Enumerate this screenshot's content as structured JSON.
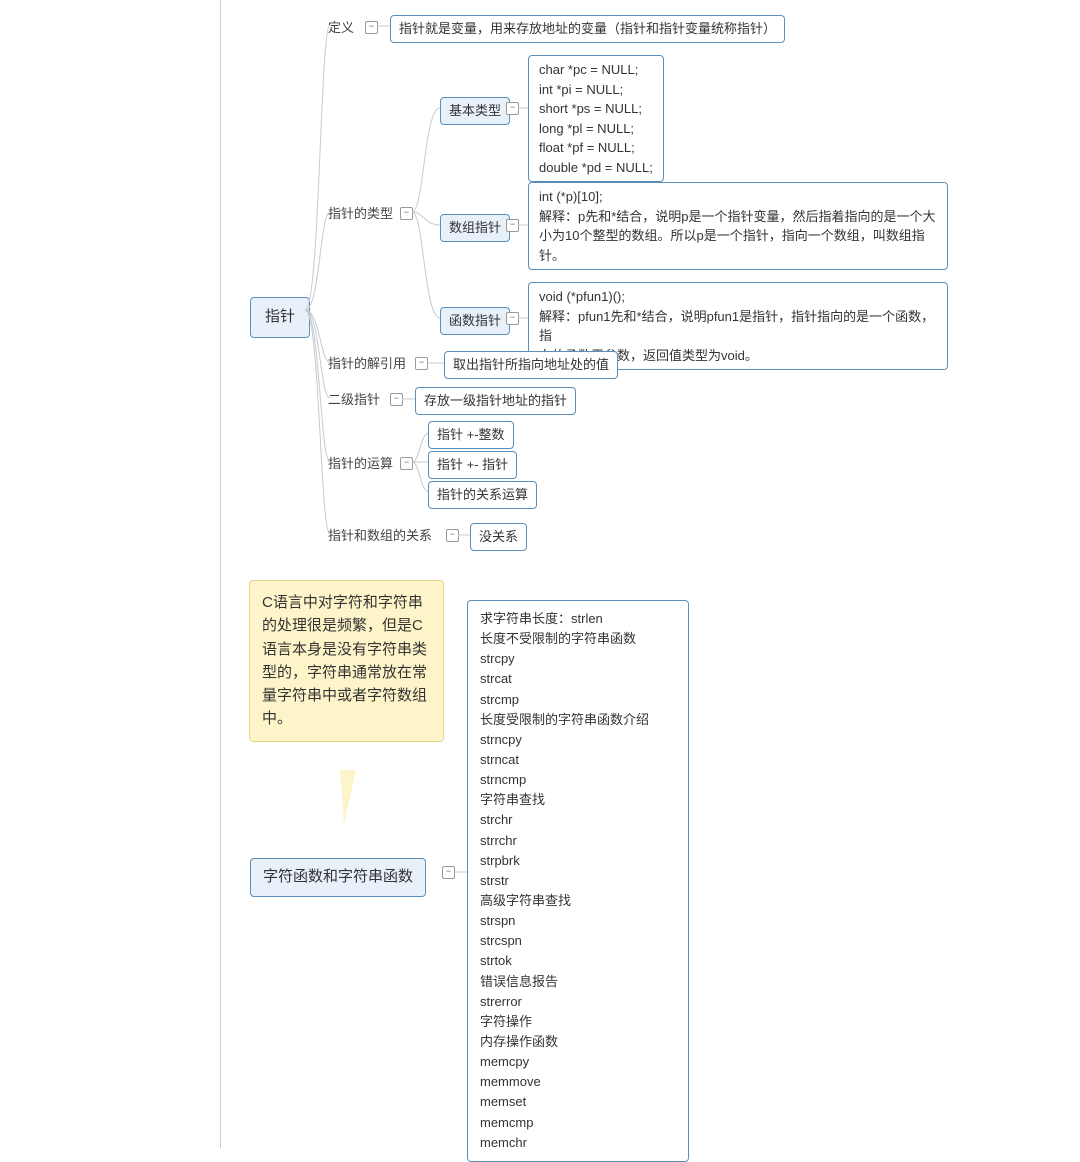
{
  "root1": "指针",
  "root2": "字符函数和字符串函数",
  "b1": "定义",
  "b1v": "指针就是变量，用来存放地址的变量（指针和指针变量统称指针）",
  "b2": "指针的类型",
  "b21": "基本类型",
  "b21v": "char *pc = NULL;\nint *pi = NULL;\nshort *ps = NULL;\nlong *pl = NULL;\nfloat *pf = NULL;\ndouble *pd = NULL;",
  "b22": "数组指针",
  "b22v": "int (*p)[10];\n解释：p先和*结合，说明p是一个指针变量，然后指着指向的是一个大小为10个整型的数组。所以p是一个指针，指向一个数组，叫数组指针。",
  "b23": "函数指针",
  "b23v": "void (*pfun1)();\n解释：pfun1先和*结合，说明pfun1是指针，指针指向的是一个函数，指\n向的函数无参数，返回值类型为void。",
  "b3": "指针的解引用",
  "b3v": "取出指针所指向地址处的值",
  "b4": "二级指针",
  "b4v": "存放一级指针地址的指针",
  "b5": "指针的运算",
  "b51": "指针 +-整数",
  "b52": "指针 +- 指针",
  "b53": "指针的关系运算",
  "b6": "指针和数组的关系",
  "b6v": "没关系",
  "note": "C语言中对字符和字符串的处理很是频繁，但是C语言本身是没有字符串类型的，字符串通常放在常量字符串中或者字符数组中。",
  "funcs": [
    "求字符串长度：strlen",
    "长度不受限制的字符串函数",
    "strcpy",
    "strcat",
    "strcmp",
    "长度受限制的字符串函数介绍",
    "strncpy",
    "strncat",
    "strncmp",
    "字符串查找",
    "strchr",
    "strrchr",
    "strpbrk",
    "strstr",
    "高级字符串查找",
    "strspn",
    "strcspn",
    "strtok",
    "错误信息报告",
    "strerror",
    "字符操作",
    "内存操作函数",
    "memcpy",
    "memmove",
    "memset",
    "memcmp",
    "memchr"
  ]
}
